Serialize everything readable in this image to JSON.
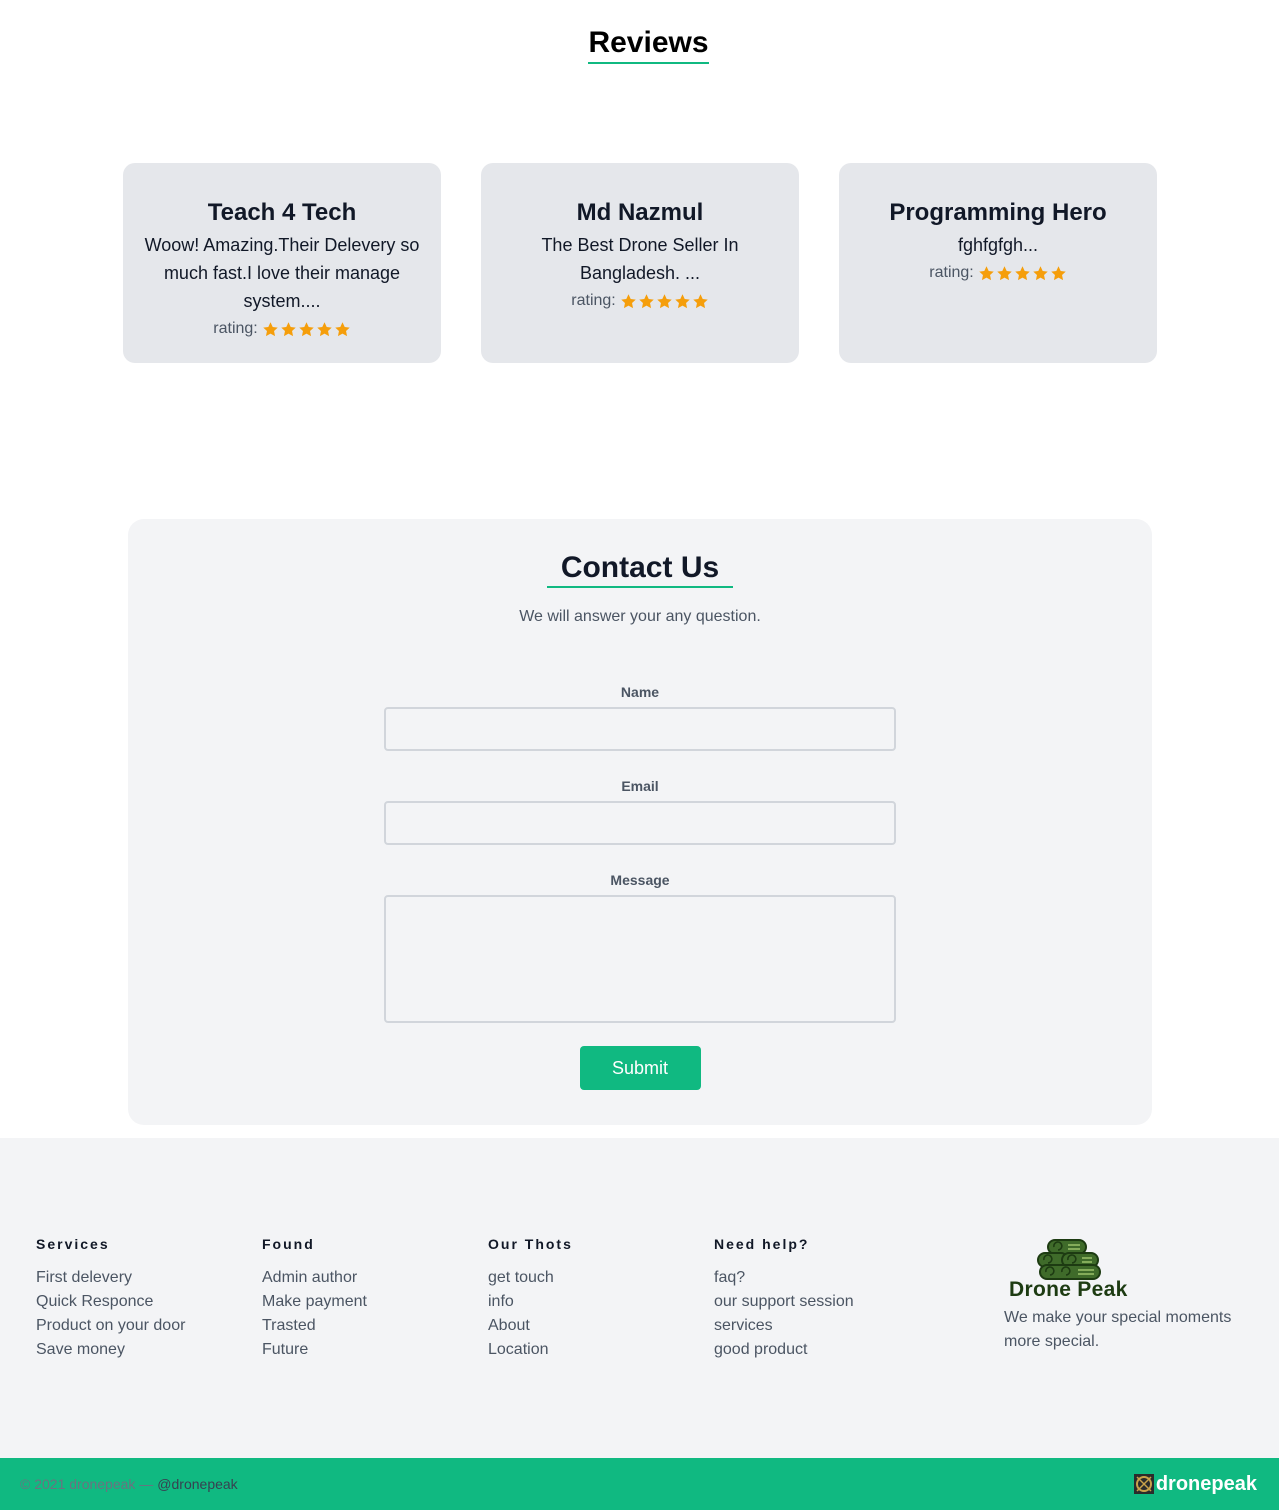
{
  "reviews": {
    "title": "Reviews",
    "rating_label": "rating:",
    "items": [
      {
        "name": "Teach 4 Tech",
        "text": "Woow! Amazing.Their Delevery so much fast.I love their manage system....",
        "rating": 5
      },
      {
        "name": "Md Nazmul",
        "text": "The Best Drone Seller In Bangladesh. ...",
        "rating": 5
      },
      {
        "name": "Programming Hero",
        "text": "fghfgfgh...",
        "rating": 5
      }
    ],
    "star_color": "#f59e0b"
  },
  "contact": {
    "title": "Contact Us",
    "subtitle": "We will answer your any question.",
    "name_label": "Name",
    "name_value": "",
    "email_label": "Email",
    "email_value": "",
    "message_label": "Message",
    "message_value": "",
    "submit_label": "Submit"
  },
  "footer": {
    "columns": [
      {
        "heading": "Services",
        "items": [
          "First delevery",
          "Quick Responce",
          "Product on your door",
          "Save money"
        ]
      },
      {
        "heading": "Found",
        "items": [
          "Admin author",
          "Make payment",
          "Trasted",
          "Future"
        ]
      },
      {
        "heading": "Our Thots",
        "items": [
          "get touch",
          "info",
          "About",
          "Location"
        ]
      },
      {
        "heading": "Need help?",
        "items": [
          "faq?",
          "our support session",
          "services",
          "good product"
        ]
      }
    ],
    "brand": {
      "name": "Drone Peak",
      "description": "We make your special moments more special."
    },
    "copyright": "© 2021 dronepeak —",
    "handle": "@dronepeak",
    "bottom_brand": "dronepeak"
  },
  "colors": {
    "accent": "#10b981",
    "card_bg": "#e5e7eb",
    "panel_bg": "#f3f4f6"
  }
}
